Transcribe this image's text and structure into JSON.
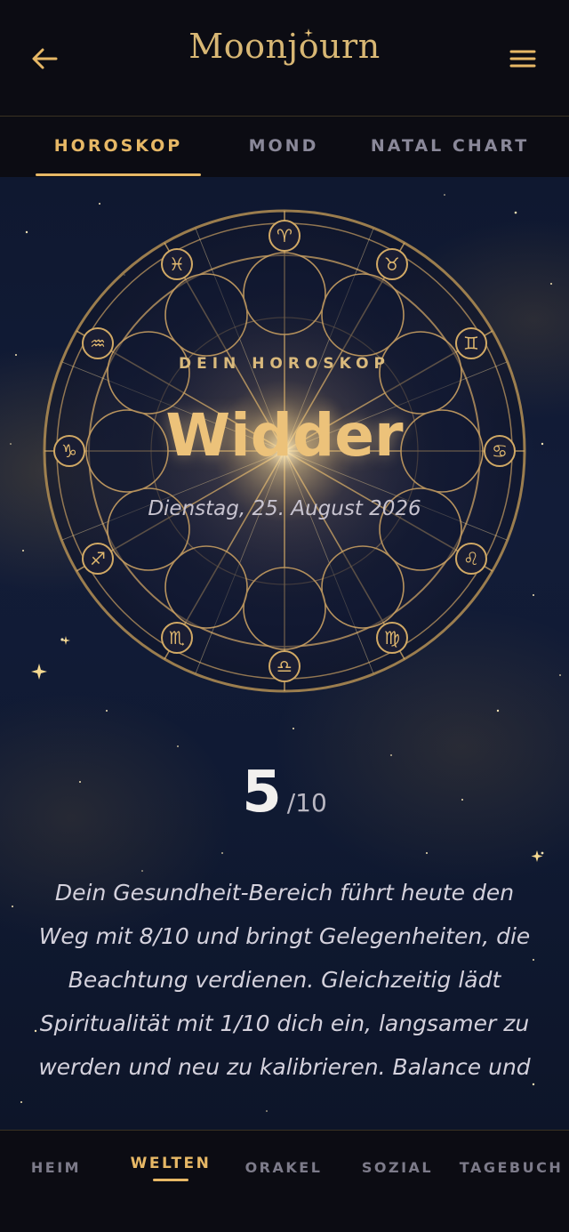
{
  "header": {
    "back_icon": "arrow-left-icon",
    "logo_text": "Moonjourn",
    "menu_icon": "hamburger-menu-icon"
  },
  "tabs": [
    {
      "label": "HOROSKOP",
      "active": true
    },
    {
      "label": "MOND",
      "active": false
    },
    {
      "label": "NATAL CHART",
      "active": false
    }
  ],
  "hero": {
    "eyebrow": "DEIN HOROSKOP",
    "sign": "Widder",
    "date": "Dienstag, 25. August 2026"
  },
  "score": {
    "value": "5",
    "max": "/10"
  },
  "reading": {
    "text": "Dein Gesundheit-Bereich führt heute den Weg mit 8/10 und bringt Gelegenheiten, die Beachtung verdienen. Gleichzeitig lädt Spiritualität mit 1/10 dich ein, langsamer zu werden und neu zu kalibrieren. Balance und"
  },
  "bottom_nav": [
    {
      "label": "HEIM",
      "active": false
    },
    {
      "label": "WELTEN",
      "active": true
    },
    {
      "label": "ORAKEL",
      "active": false
    },
    {
      "label": "SOZIAL",
      "active": false
    },
    {
      "label": "TAGEBUCH",
      "active": false
    }
  ],
  "colors": {
    "accent": "#e7b866",
    "background": "#0b0b12",
    "inactive": "#8a8899"
  }
}
